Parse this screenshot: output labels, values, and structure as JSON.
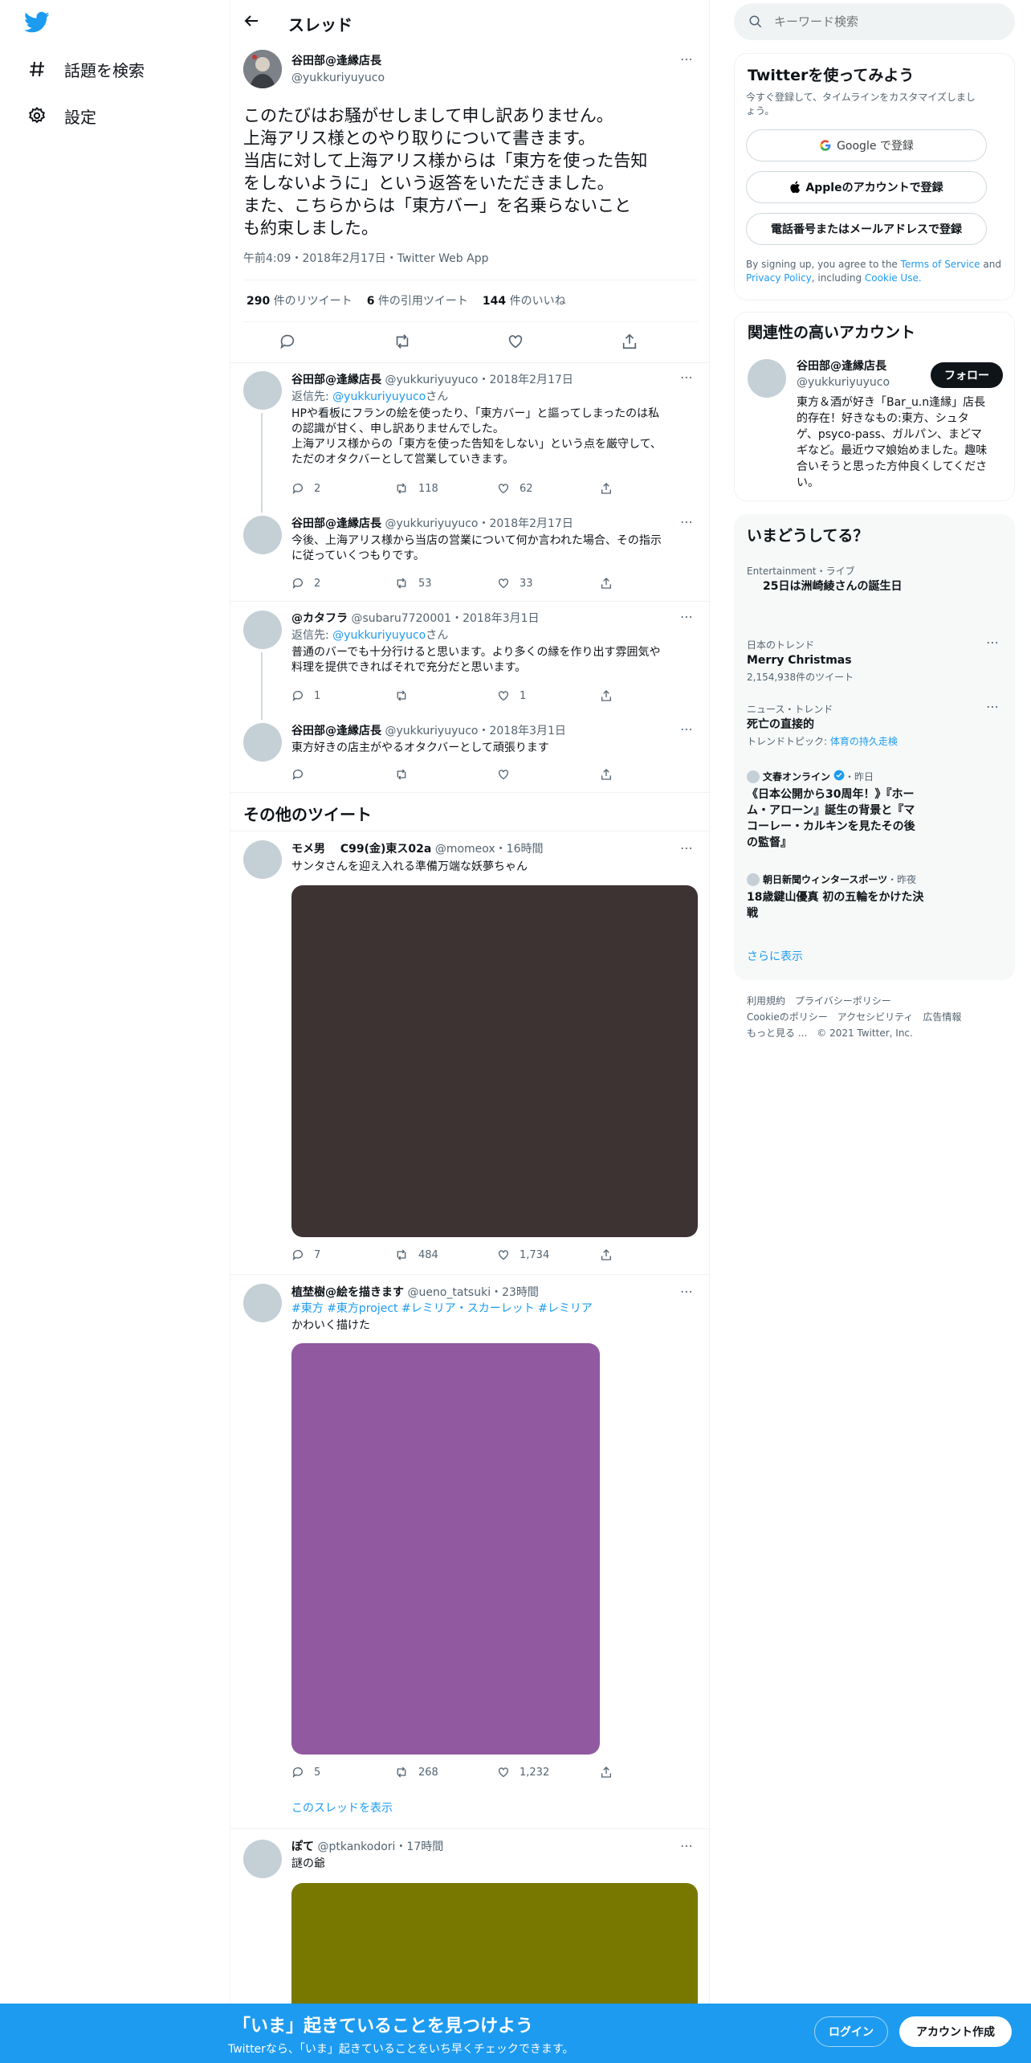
{
  "nav": {
    "explore": "話題を検索",
    "settings": "設定"
  },
  "header": {
    "title": "スレッド"
  },
  "main_tweet": {
    "name": "谷田部@逢縁店長",
    "handle": "@yukkuriyuyuco",
    "lines": [
      "このたびはお騒がせしまして申し訳ありません。",
      "上海アリス様とのやり取りについて書きます。",
      "当店に対して上海アリス様からは「東方を使った告知",
      "をしないように」という返答をいただきました。",
      "また、こちらからは「東方バー」を名乗らないこと",
      "も約束しました。"
    ],
    "meta": "午前4:09・2018年2月17日・Twitter Web App",
    "retweets": "290",
    "retweets_label": "件のリツイート",
    "quotes": "6",
    "quotes_label": "件の引用ツイート",
    "likes": "144",
    "likes_label": "件のいいね"
  },
  "replies": [
    {
      "name": "谷田部@逢縁店長",
      "meta": "@yukkuriyuyuco・2018年2月17日",
      "reply_to_prefix": "返信先: ",
      "reply_to": "@yukkuriyuyuco",
      "reply_to_suffix": "さん",
      "lines": [
        "HPや看板にフランの絵を使ったり、「東方バー」と謳ってしまったのは私",
        "の認識が甘く、申し訳ありませんでした。",
        "上海アリス様からの「東方を使った告知をしない」という点を厳守して、",
        "ただのオタクバーとして営業していきます。"
      ],
      "stats": [
        "2",
        "118",
        "62"
      ]
    },
    {
      "name": "谷田部@逢縁店長",
      "meta": "@yukkuriyuyuco・2018年2月17日",
      "lines": [
        "今後、上海アリス様から当店の営業について何か言われた場合、その指示",
        "に従っていくつもりです。"
      ],
      "stats": [
        "2",
        "53",
        "33"
      ]
    },
    {
      "name": "@カタフラ",
      "meta": "@subaru7720001・2018年3月1日",
      "reply_to_prefix": "返信先: ",
      "reply_to": "@yukkuriyuyuco",
      "reply_to_suffix": "さん",
      "lines": [
        "普通のバーでも十分行けると思います。より多くの縁を作り出す雰囲気や",
        "料理を提供できればそれで充分だと思います。"
      ],
      "stats": [
        "1",
        "",
        "1"
      ]
    },
    {
      "name": "谷田部@逢縁店長",
      "meta": "@yukkuriyuyuco・2018年3月1日",
      "lines": [
        "東方好きの店主がやるオタクバーとして頑張ります"
      ],
      "stats": [
        "",
        "",
        ""
      ]
    }
  ],
  "more_tweets_heading": "その他のツイート",
  "more": [
    {
      "name": "モメ男　 C99(金)東ス02a",
      "meta": "@momeox・16時間",
      "text": "サンタさんを迎え入れる準備万端な妖夢ちゃん",
      "media_color": "#3e3333",
      "stats": [
        "7",
        "484",
        "1,734"
      ]
    },
    {
      "name": "植埜樹@絵を描きます",
      "meta": "@ueno_tatsuki・23時間",
      "hashtags": [
        "#東方",
        "#東方project",
        "#レミリア・スカーレット",
        "#レミリア"
      ],
      "text": "かわいく描けた",
      "media_color": "#9159a0",
      "stats": [
        "5",
        "268",
        "1,232"
      ],
      "show_thread": "このスレッドを表示"
    },
    {
      "name": "ぽて",
      "meta": "@ptkankodori・17時間",
      "text": "謎の爺",
      "media_color": "#787800"
    }
  ],
  "search": {
    "placeholder": "キーワード検索"
  },
  "signup": {
    "title": "Twitterを使ってみよう",
    "subtitle_1": "今すぐ登録して、タイムラインをカスタマイズしまし",
    "subtitle_2": "ょう。",
    "google": "Google で登録",
    "apple": "Appleのアカウントで登録",
    "phone": "電話番号またはメールアドレスで登録",
    "terms_1": "By signing up, you agree to the",
    "terms_link": "Terms of Service",
    "terms_2": "and",
    "privacy_link": "Privacy Policy",
    "terms_3": ", including",
    "cookie_link": "Cookie Use."
  },
  "related": {
    "title": "関連性の高いアカウント",
    "name": "谷田部@逢縁店長",
    "handle": "@yukkuriyuyuco",
    "follow": "フォロー",
    "bio": [
      "東方＆酒が好き「Bar_u.n逢縁」店長",
      "的存在！好きなもの:東方、シュタ",
      "ゲ、psyco-pass、ガルパン、まどマ",
      "ギなど。最近ウマ娘始めました。趣味",
      "合いそうと思った方仲良くしてくださ",
      "い。"
    ]
  },
  "trends": {
    "title": "いまどうしてる？",
    "items": [
      {
        "context": "Entertainment・ライブ",
        "name": "25日は洲崎綾さんの誕生日"
      },
      {
        "context": "日本のトレンド",
        "name": "Merry Christmas",
        "count": "2,154,938件のツイート"
      },
      {
        "context": "ニュース・トレンド",
        "name": "死亡の直接的",
        "sub_prefix": "トレンドトピック: ",
        "sub_link": "体育の持久走検"
      }
    ],
    "news": [
      {
        "source": "文春オンライン",
        "time": "・昨日",
        "lines": [
          "《日本公開から30周年！》『ホー",
          "ム・アローン』誕生の背景と『マ",
          "コーレー・カルキンを見たその後",
          "の監督』"
        ]
      },
      {
        "source": "朝日新聞ウィンタースポーツ",
        "time": "・昨夜",
        "lines": [
          "18歳鍵山優真 初の五輪をかけた決",
          "戦"
        ]
      }
    ],
    "show_more": "さらに表示"
  },
  "footer": {
    "row1": [
      "利用規約",
      "プライバシーポリシー"
    ],
    "row2": [
      "Cookieのポリシー",
      "アクセシビリティ",
      "広告情報"
    ],
    "row3": [
      "もっと見る ...",
      "© 2021 Twitter, Inc."
    ]
  },
  "bottom": {
    "headline": "「いま」起きていることを見つけよう",
    "sub": "Twitterなら、「いま」起きていることをいち早くチェックできます。",
    "login": "ログイン",
    "signup": "アカウント作成"
  },
  "colors": {
    "brand": "#1d9bf0",
    "text": "#0f1419",
    "muted": "#536471"
  }
}
